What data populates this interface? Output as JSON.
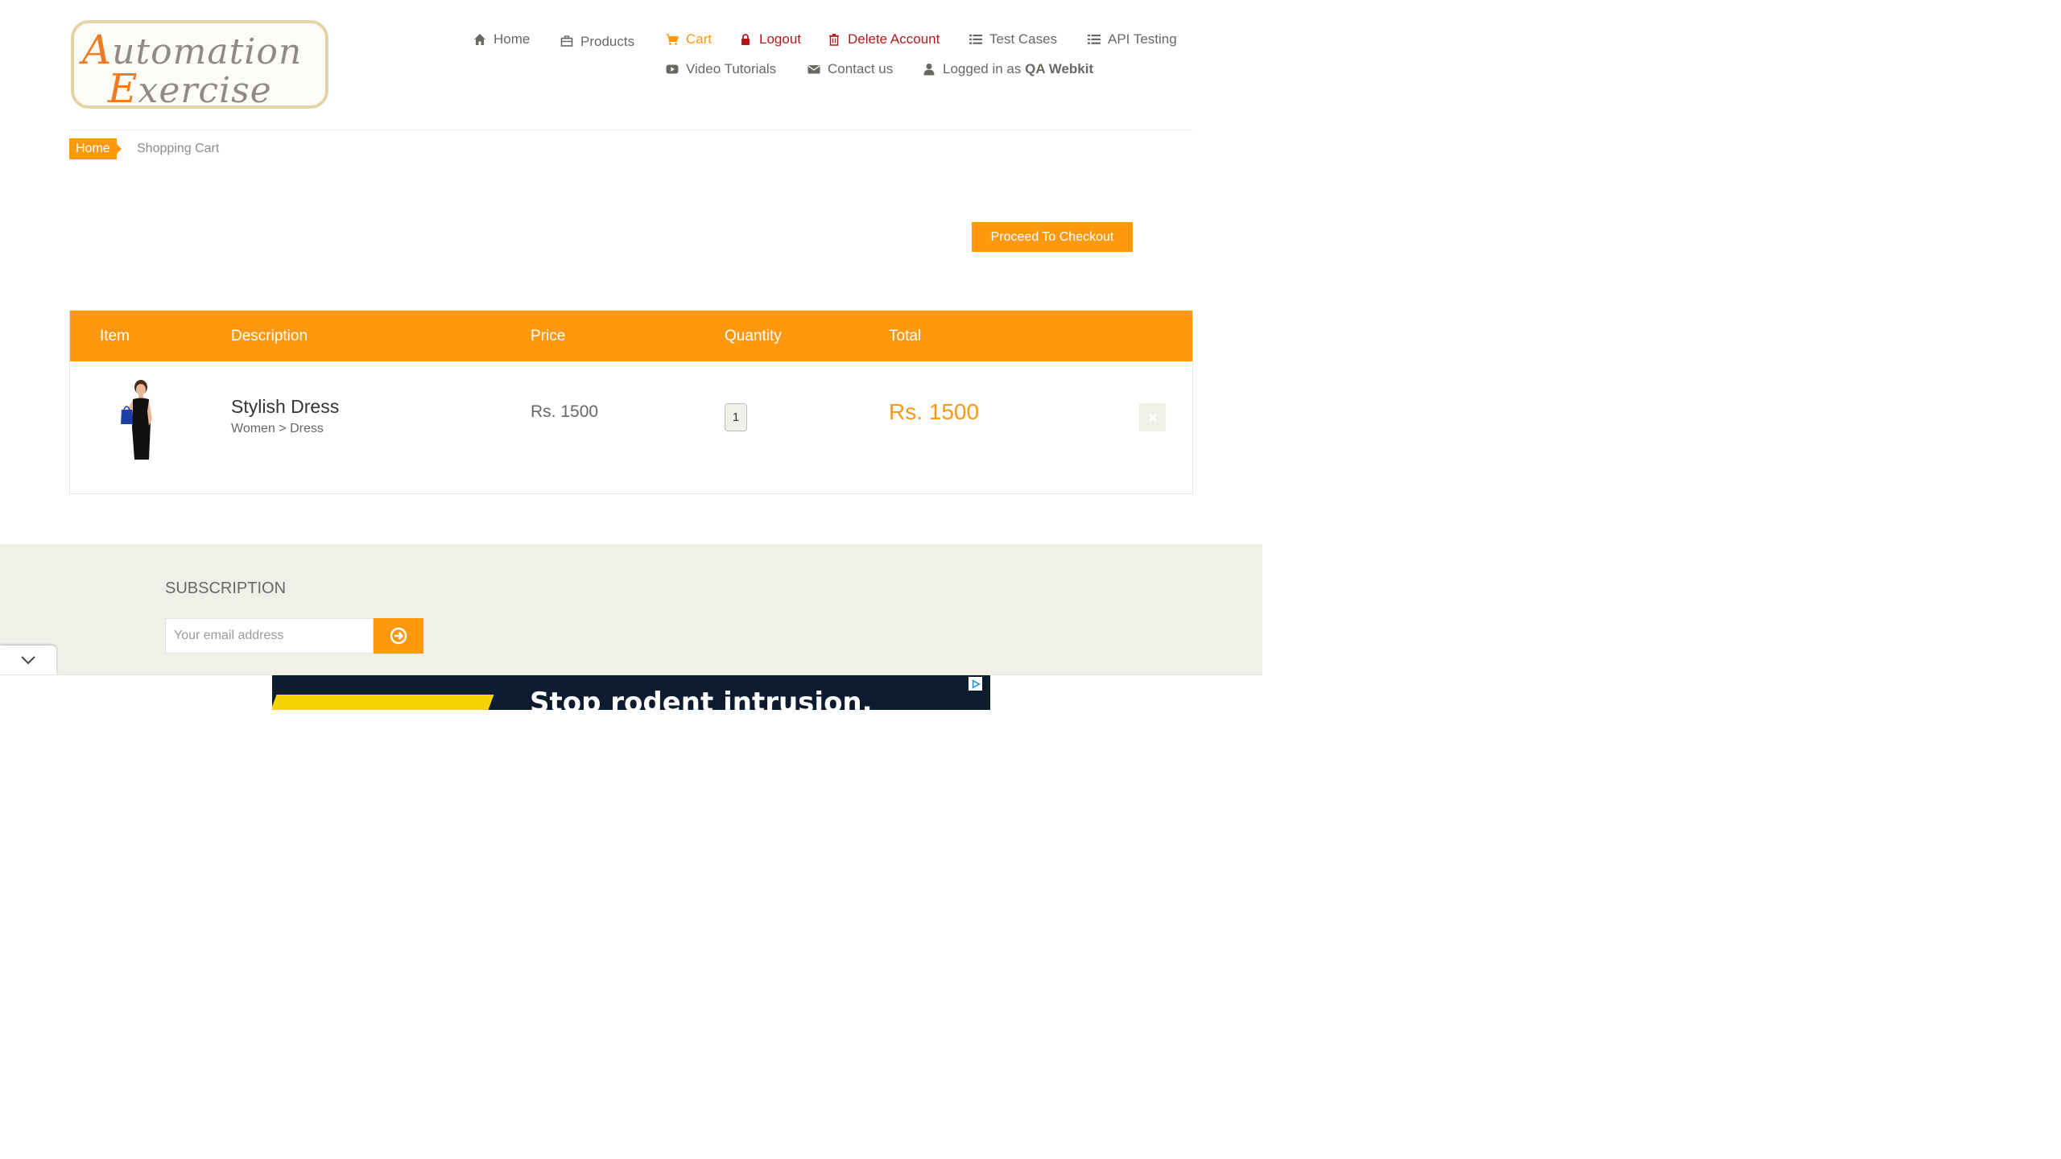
{
  "logo": {
    "line1_cap": "A",
    "line1_rest": "utomation",
    "line2_cap": "E",
    "line2_rest": "xercise"
  },
  "nav": {
    "home": "Home",
    "products": "Products",
    "cart": "Cart",
    "logout": "Logout",
    "delete_account": "Delete Account",
    "test_cases": "Test Cases",
    "api_testing": "API Testing",
    "video_tutorials": "Video Tutorials",
    "contact_us": "Contact us",
    "logged_in_prefix": "Logged in as",
    "username": "QA Webkit"
  },
  "breadcrumb": {
    "home": "Home",
    "current": "Shopping Cart"
  },
  "checkout_button": "Proceed To Checkout",
  "cart": {
    "headers": {
      "item": "Item",
      "description": "Description",
      "price": "Price",
      "quantity": "Quantity",
      "total": "Total"
    },
    "items": [
      {
        "name": "Stylish Dress",
        "category": "Women > Dress",
        "price": "Rs. 1500",
        "quantity": "1",
        "total": "Rs. 1500"
      }
    ]
  },
  "subscription": {
    "title": "SUBSCRIPTION",
    "placeholder": "Your email address"
  },
  "ad": {
    "headline": "Stop rodent intrusion."
  },
  "colors": {
    "accent": "#fe980f",
    "danger": "#b0181c",
    "footer_bg": "#f0f0e9"
  }
}
